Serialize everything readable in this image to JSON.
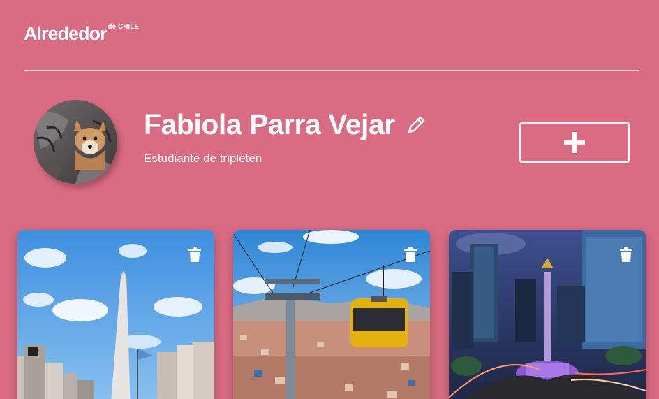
{
  "header": {
    "logo_main": "Alrededor",
    "logo_sup": "de CHILE"
  },
  "profile": {
    "name": "Fabiola Parra Vejar",
    "job": "Estudiante de tripleten",
    "avatar_icon": "fox-avatar",
    "edit_icon": "pencil-icon"
  },
  "actions": {
    "add_icon": "plus-icon"
  },
  "cards": [
    {
      "delete_icon": "trash-icon",
      "scene": "obelisk"
    },
    {
      "delete_icon": "trash-icon",
      "scene": "cable-car"
    },
    {
      "delete_icon": "trash-icon",
      "scene": "angel-monument"
    }
  ],
  "colors": {
    "background": "#d96b83",
    "text": "#ffffff"
  }
}
